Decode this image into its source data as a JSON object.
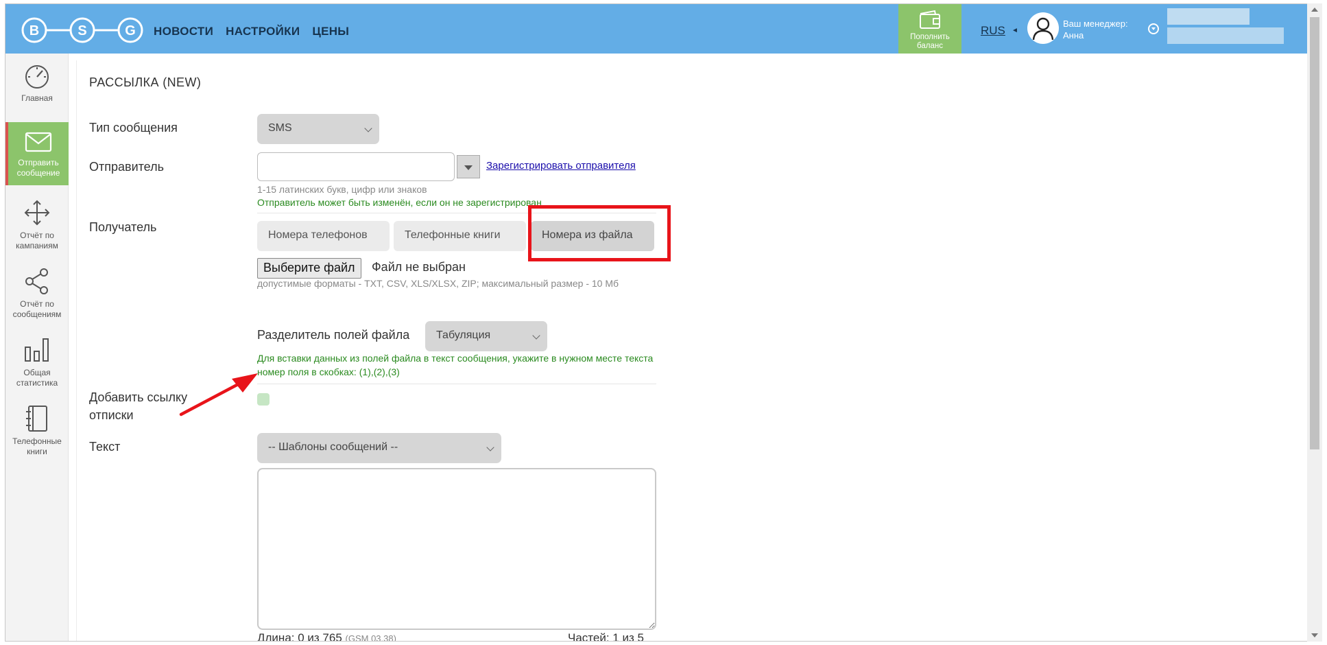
{
  "header": {
    "logo_letters": [
      "B",
      "S",
      "G"
    ],
    "nav": [
      "НОВОСТИ",
      "НАСТРОЙКИ",
      "ЦЕНЫ"
    ],
    "topup_label_line1": "Пополнить",
    "topup_label_line2": "баланс",
    "lang": "RUS",
    "manager_caption": "Ваш менеджер:",
    "manager_name": "Анна",
    "header_color": "#63ade6",
    "accent_green": "#8cc46b"
  },
  "sidebar": {
    "items": [
      {
        "label": "Главная",
        "icon": "speedometer-icon"
      },
      {
        "label": "Отправить сообщение",
        "icon": "envelope-icon",
        "active": true
      },
      {
        "label": "Отчёт по кампаниям",
        "icon": "move-arrows-icon"
      },
      {
        "label": "Отчёт по сообщениям",
        "icon": "share-icon"
      },
      {
        "label": "Общая статистика",
        "icon": "bar-chart-icon"
      },
      {
        "label": "Телефонные книги",
        "icon": "notebook-icon"
      }
    ]
  },
  "form": {
    "title": "РАССЫЛКА (NEW)",
    "message_type_label": "Тип сообщения",
    "message_type_value": "SMS",
    "sender_label": "Отправитель",
    "sender_value": "",
    "register_sender_link": "Зарегистрировать отправителя",
    "sender_hint": "1-15 латинских букв, цифр или знаков",
    "sender_note": "Отправитель может быть изменён, если он не зарегистрирован",
    "recipient_label": "Получатель",
    "recipient_tabs": [
      "Номера телефонов",
      "Телефонные книги",
      "Номера из файла"
    ],
    "active_tab": "Номера из файла",
    "choose_file_button": "Выберите файл",
    "no_file": "Файл не выбран",
    "formats_hint": "допустимые форматы - TXT, CSV, XLS/XLSX, ZIP; максимальный размер - 10 Мб",
    "separator_label": "Разделитель полей файла",
    "separator_value": "Табуляция",
    "fields_hint": "Для вставки данных из полей файла в текст сообщения, укажите в нужном месте текста номер поля в скобках: (1),(2),(3)",
    "unsubscribe_label": "Добавить ссылку отписки",
    "text_label": "Текст",
    "templates_value": "-- Шаблоны сообщений --",
    "message_text": "",
    "length_text": "Длина: 0 из 765",
    "encoding_text": "(GSM 03.38)",
    "parts_text": "Частей: 1 из 5"
  }
}
